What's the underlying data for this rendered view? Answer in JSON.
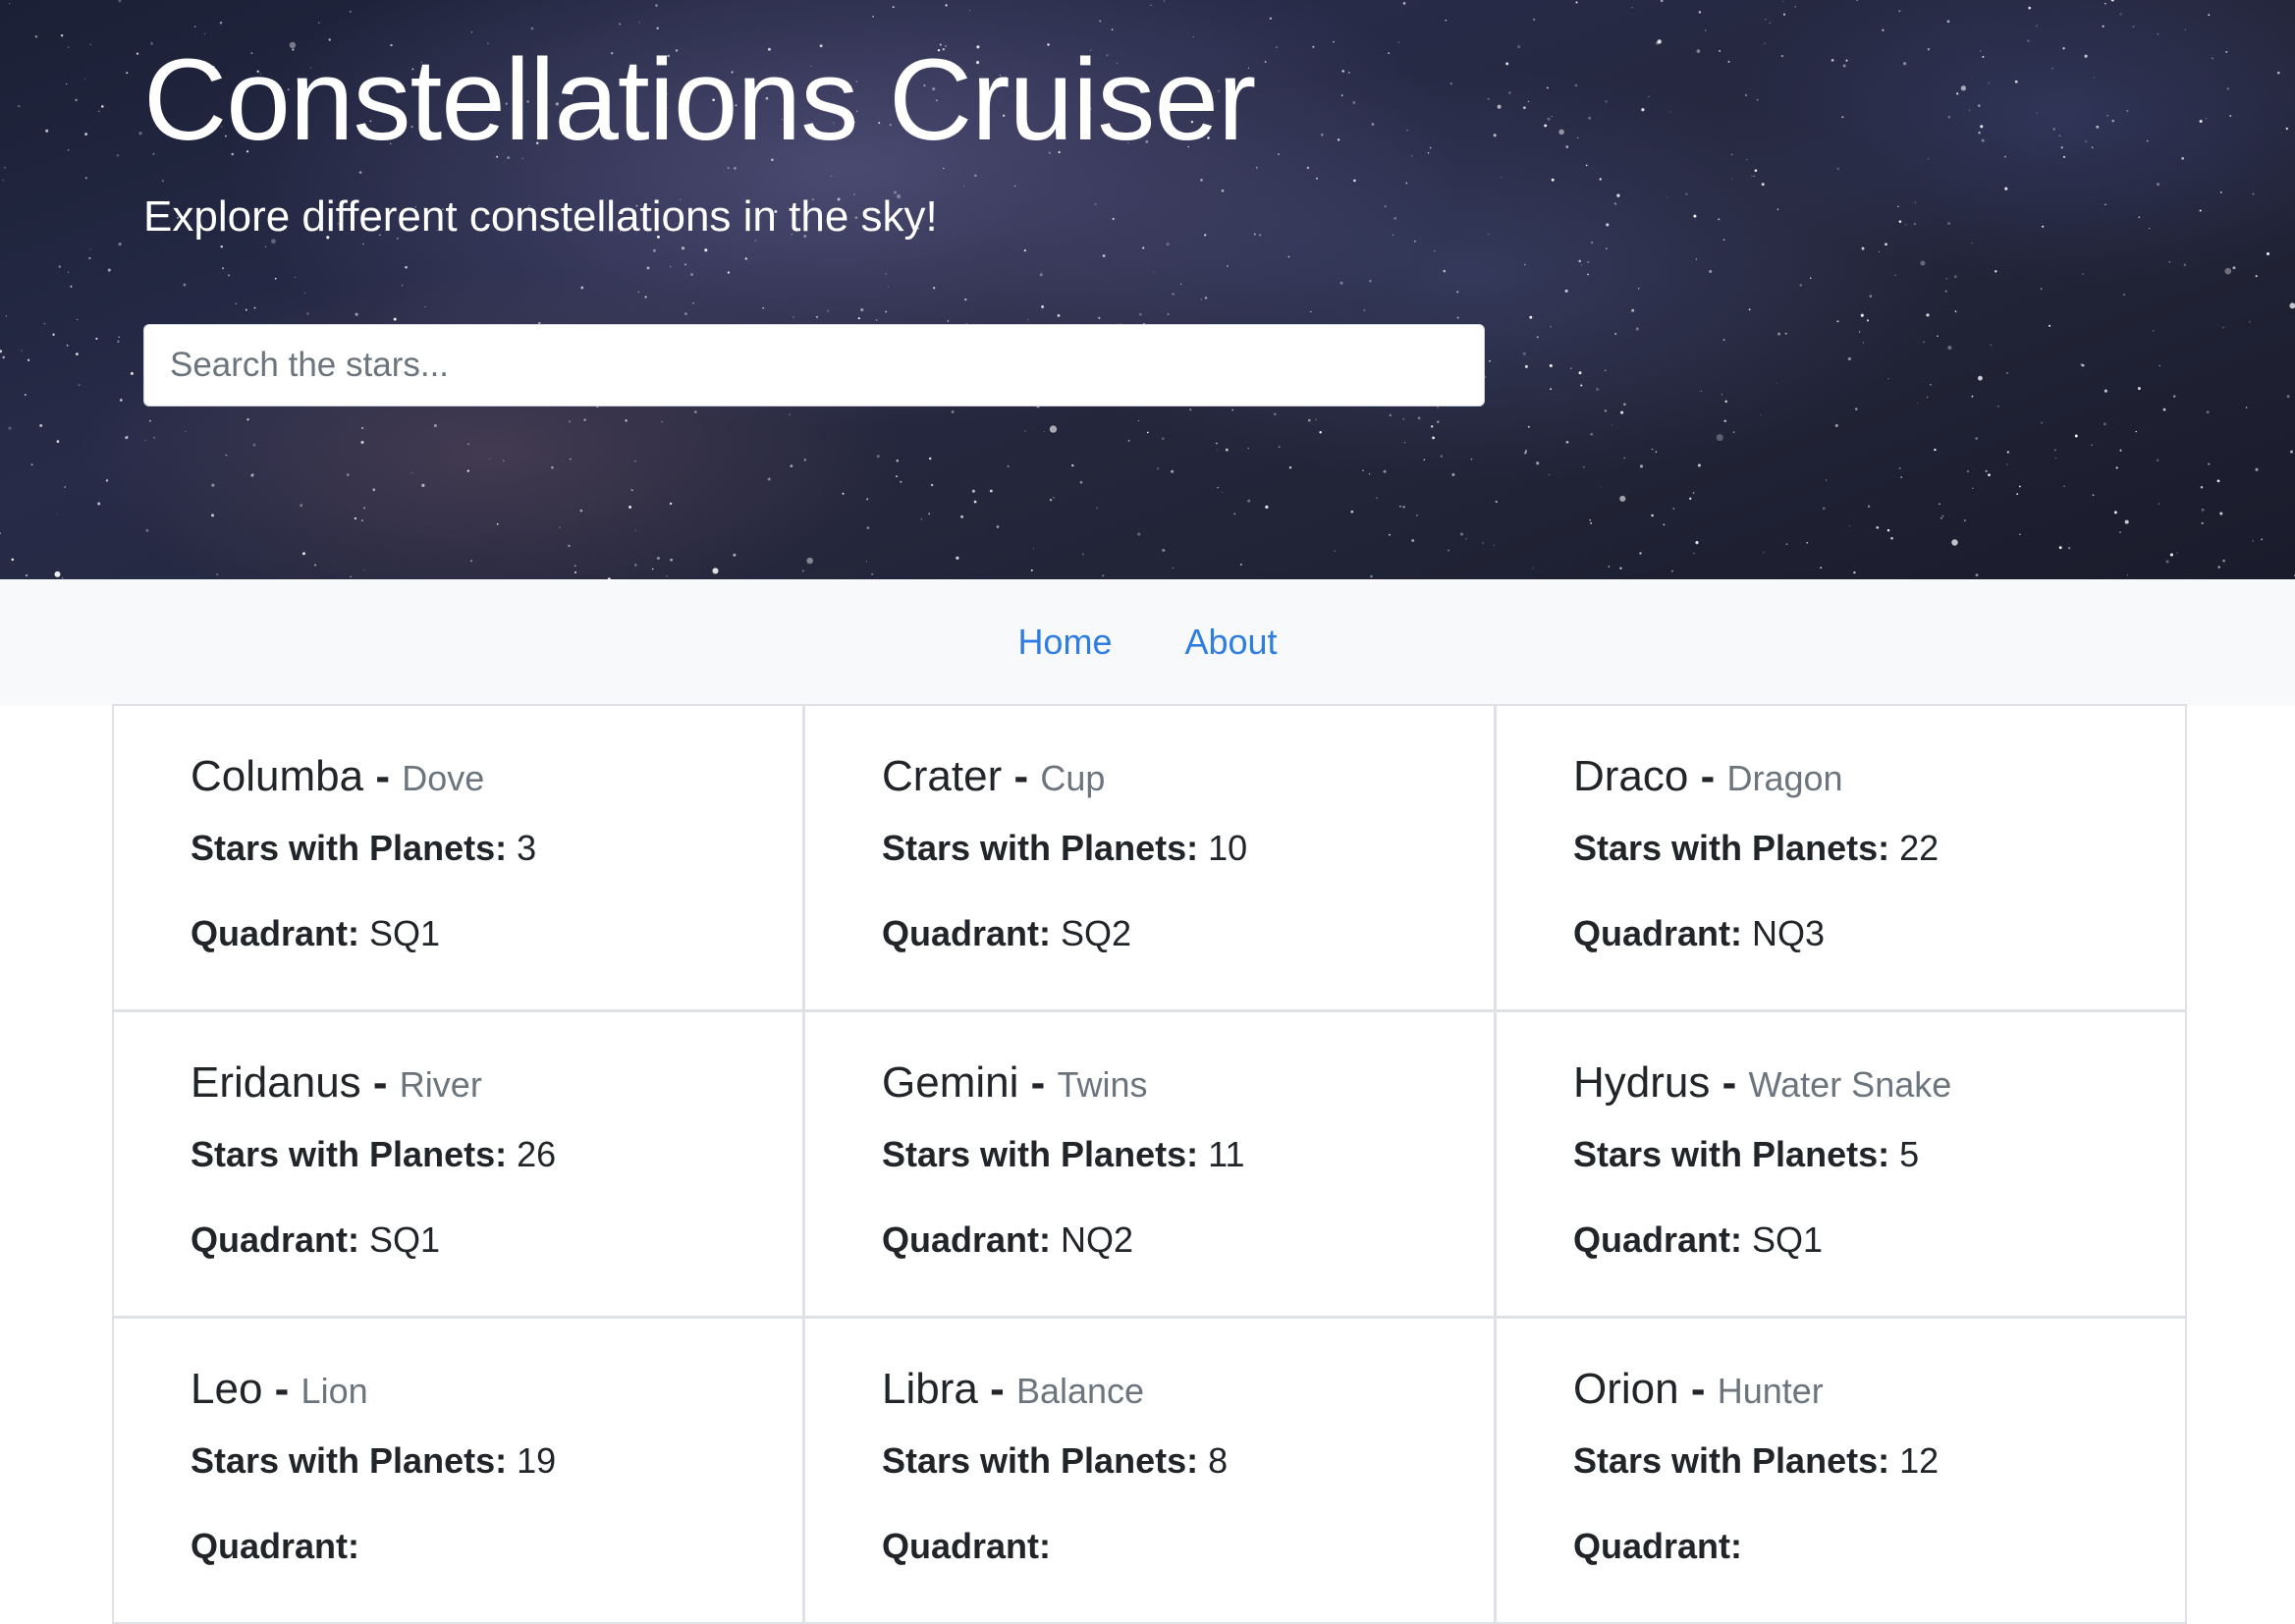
{
  "hero": {
    "title": "Constellations Cruiser",
    "subtitle": "Explore different constellations in the sky!",
    "search_placeholder": "Search the stars..."
  },
  "nav": {
    "items": [
      {
        "label": "Home"
      },
      {
        "label": "About"
      }
    ]
  },
  "labels": {
    "stars_with_planets": "Stars with Planets:",
    "quadrant": "Quadrant:",
    "separator": "-"
  },
  "constellations": [
    {
      "name": "Columba",
      "meaning": "Dove",
      "stars_with_planets": "3",
      "quadrant": "SQ1"
    },
    {
      "name": "Crater",
      "meaning": "Cup",
      "stars_with_planets": "10",
      "quadrant": "SQ2"
    },
    {
      "name": "Draco",
      "meaning": "Dragon",
      "stars_with_planets": "22",
      "quadrant": "NQ3"
    },
    {
      "name": "Eridanus",
      "meaning": "River",
      "stars_with_planets": "26",
      "quadrant": "SQ1"
    },
    {
      "name": "Gemini",
      "meaning": "Twins",
      "stars_with_planets": "11",
      "quadrant": "NQ2"
    },
    {
      "name": "Hydrus",
      "meaning": "Water Snake",
      "stars_with_planets": "5",
      "quadrant": "SQ1"
    },
    {
      "name": "Leo",
      "meaning": "Lion",
      "stars_with_planets": "19",
      "quadrant": ""
    },
    {
      "name": "Libra",
      "meaning": "Balance",
      "stars_with_planets": "8",
      "quadrant": ""
    },
    {
      "name": "Orion",
      "meaning": "Hunter",
      "stars_with_planets": "12",
      "quadrant": ""
    }
  ]
}
